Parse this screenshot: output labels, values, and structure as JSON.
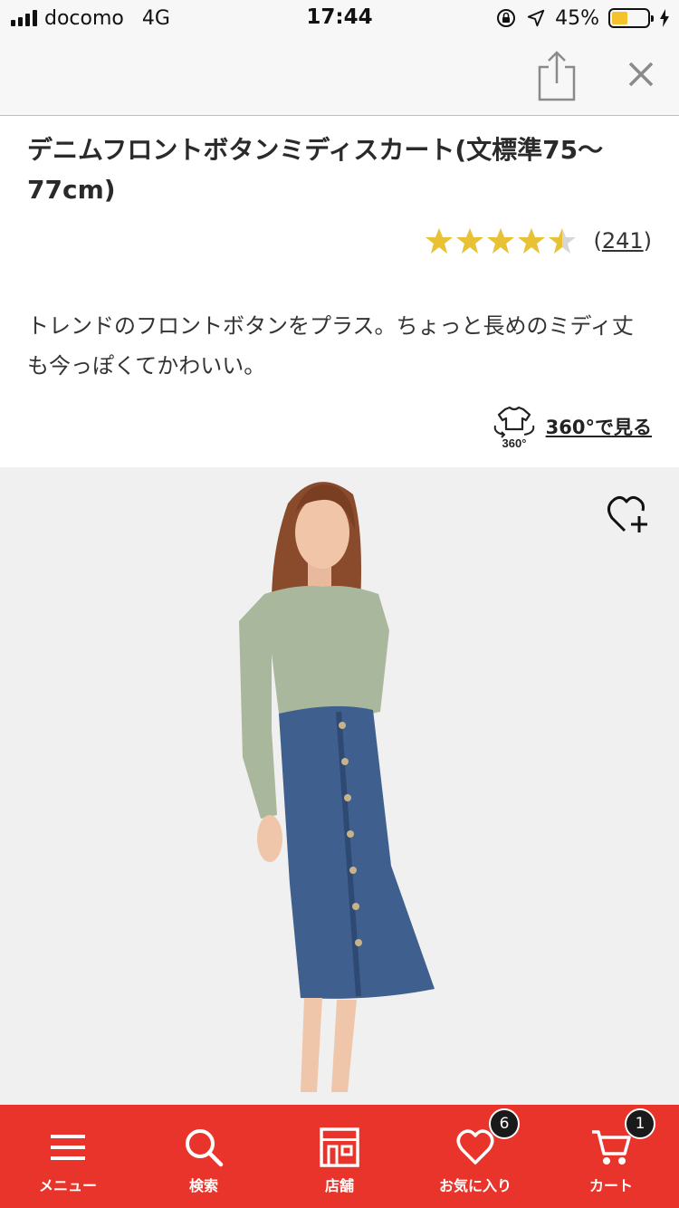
{
  "status_bar": {
    "carrier": "docomo",
    "network": "4G",
    "time": "17:44",
    "battery_percent": "45%",
    "battery_level": 0.45
  },
  "header": {
    "share_icon": "share-icon",
    "close_icon": "close-icon"
  },
  "product": {
    "title": "デニムフロントボタンミディスカート(文標準75〜77cm)",
    "rating": 4.5,
    "review_count_open": "(",
    "review_count": "241",
    "review_count_close": ")",
    "description": "トレンドのフロントボタンをプラス。ちょっと長めのミディ丈も今っぽくてかわいい。",
    "view360_badge": "360°",
    "view360_label": "360°で見る",
    "star_color": "#e8c234",
    "star_empty_color": "#d6d6d6"
  },
  "tabbar": {
    "color": "#e8342a",
    "items": [
      {
        "label": "メニュー",
        "icon": "menu-icon"
      },
      {
        "label": "検索",
        "icon": "search-icon"
      },
      {
        "label": "店舗",
        "icon": "store-icon"
      },
      {
        "label": "お気に入り",
        "icon": "heart-icon",
        "badge": "6"
      },
      {
        "label": "カート",
        "icon": "cart-icon",
        "badge": "1"
      }
    ]
  }
}
